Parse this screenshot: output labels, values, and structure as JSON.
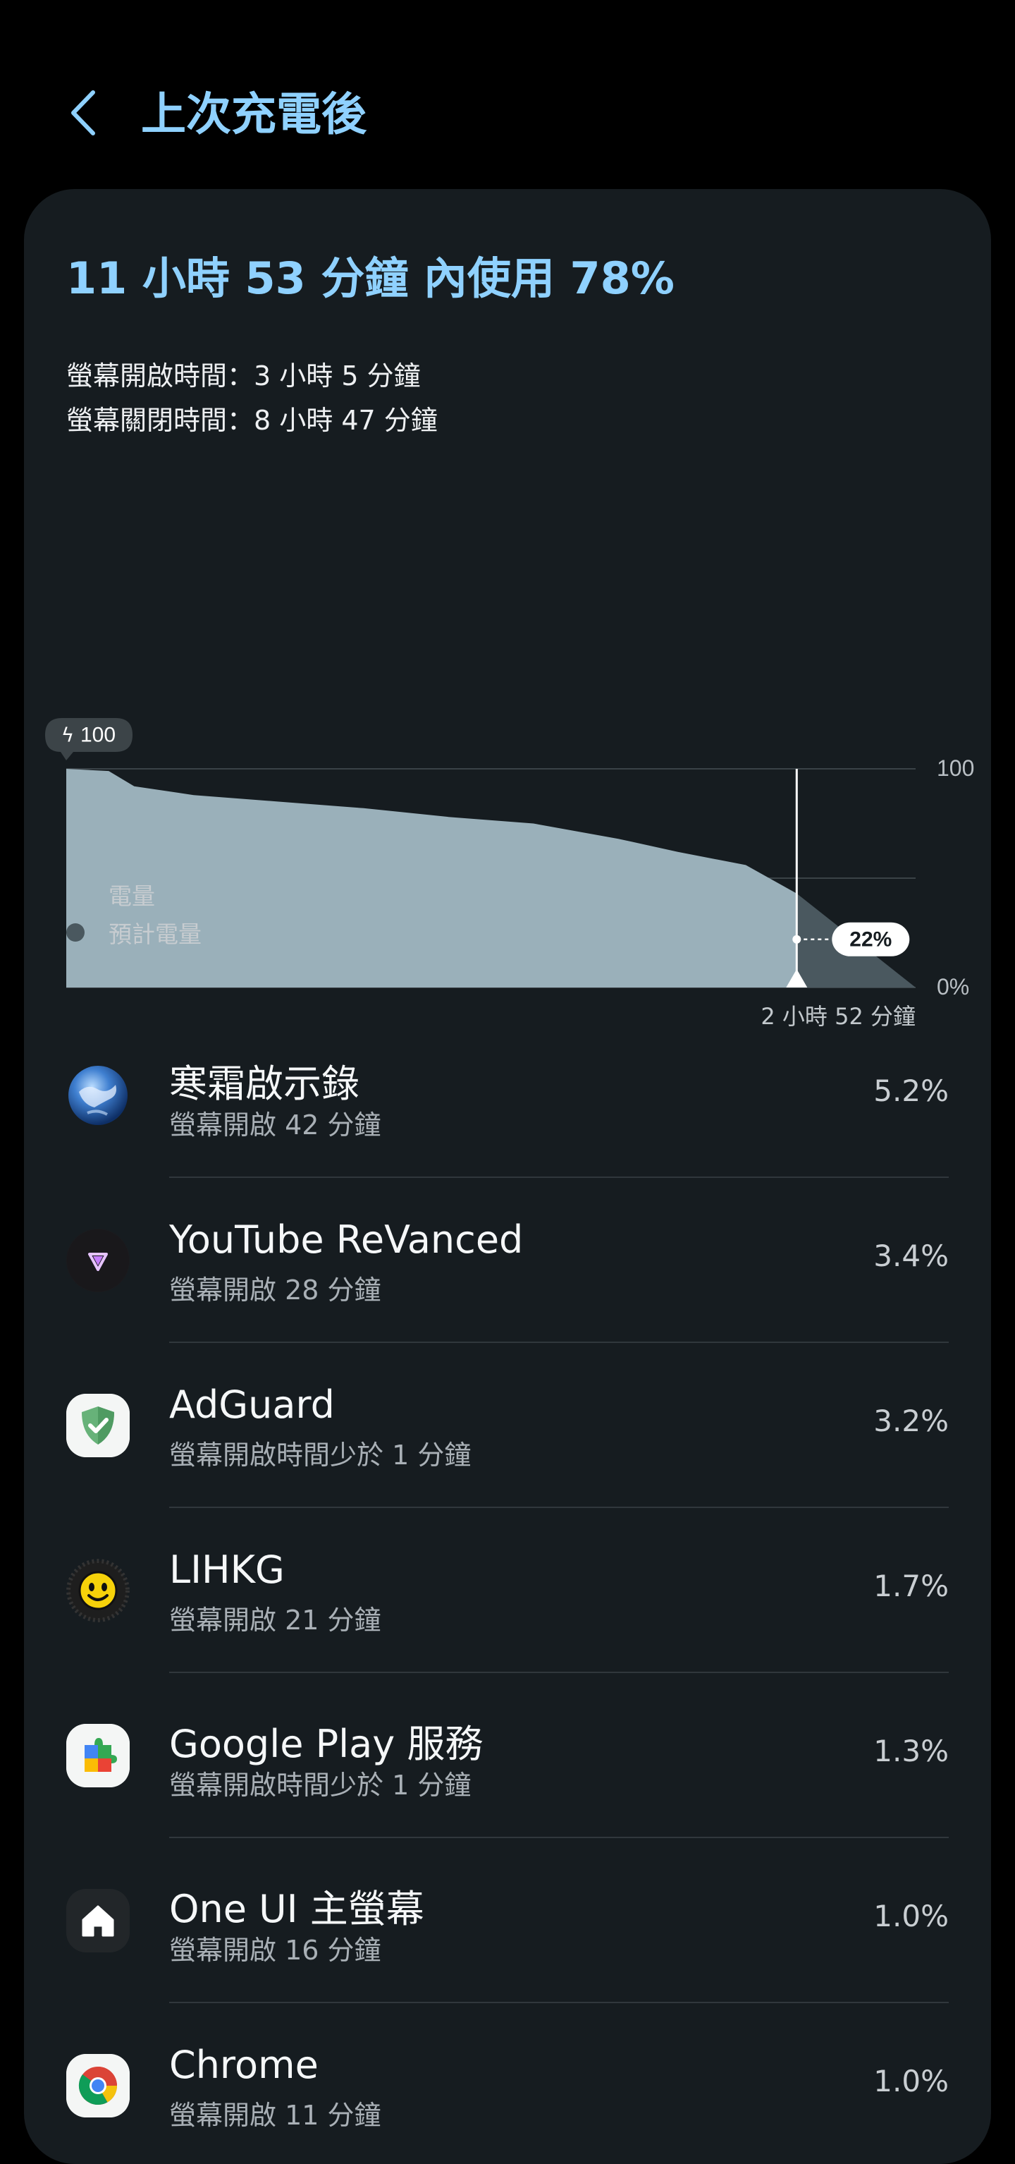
{
  "header": {
    "title": "上次充電後"
  },
  "summary": {
    "headline": "11 小時 53 分鐘 內使用 78%",
    "screen_on": "螢幕開啟時間：3 小時 5 分鐘",
    "screen_off": "螢幕關閉時間：8 小時 47 分鐘"
  },
  "chart_data": {
    "type": "area",
    "title": "",
    "xlabel": "",
    "ylabel": "",
    "ylim": [
      0,
      100
    ],
    "y_ticks": [
      "100",
      "0%"
    ],
    "charge_badge": "100",
    "current_label": "22%",
    "remaining_label": "2 小時 52 分鐘",
    "grid": true,
    "colors": {
      "charge": "#9ab0ba",
      "projected": "#4a585f"
    },
    "series": [
      {
        "name": "電量",
        "x": [
          0,
          0.05,
          0.08,
          0.15,
          0.25,
          0.35,
          0.45,
          0.55,
          0.65,
          0.72,
          0.8,
          0.86
        ],
        "values": [
          100,
          99,
          92,
          88,
          85,
          82,
          78,
          75,
          68,
          62,
          56,
          43
        ]
      },
      {
        "name": "預計電量",
        "x": [
          0.86,
          1.0
        ],
        "values": [
          43,
          22
        ]
      }
    ],
    "legend": [
      "電量",
      "預計電量"
    ]
  },
  "apps": [
    {
      "name": "寒霜啟示錄",
      "sub": "螢幕開啟 42 分鐘",
      "pct": "5.2%",
      "icon": "globe-game-icon"
    },
    {
      "name": "YouTube ReVanced",
      "sub": "螢幕開啟 28 分鐘",
      "pct": "3.4%",
      "icon": "revanced-icon"
    },
    {
      "name": "AdGuard",
      "sub": "螢幕開啟時間少於 1 分鐘",
      "pct": "3.2%",
      "icon": "shield-check-icon"
    },
    {
      "name": "LIHKG",
      "sub": "螢幕開啟 21 分鐘",
      "pct": "1.7%",
      "icon": "smiley-face-icon"
    },
    {
      "name": "Google Play 服務",
      "sub": "螢幕開啟時間少於 1 分鐘",
      "pct": "1.3%",
      "icon": "puzzle-piece-icon"
    },
    {
      "name": "One UI 主螢幕",
      "sub": "螢幕開啟 16 分鐘",
      "pct": "1.0%",
      "icon": "home-icon"
    },
    {
      "name": "Chrome",
      "sub": "螢幕開啟 11 分鐘",
      "pct": "1.0%",
      "icon": "chrome-icon"
    }
  ],
  "colors": {
    "accent": "#8fd1ff",
    "background": "#000000",
    "card": "#161c20"
  }
}
